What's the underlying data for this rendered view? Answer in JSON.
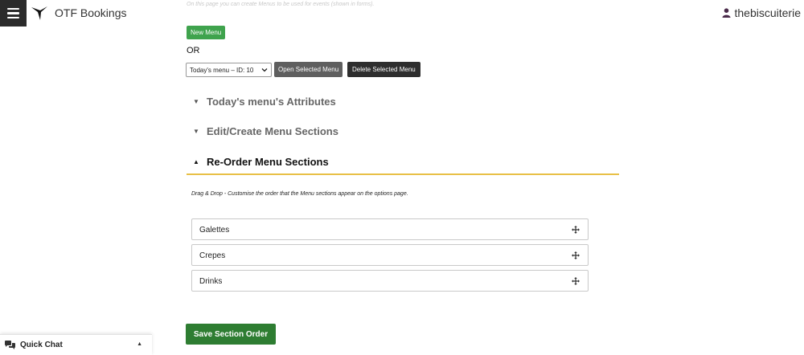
{
  "header": {
    "app_title": "OTF Bookings",
    "username": "thebiscuiterie",
    "menu_icon": "hamburger-icon",
    "logo_icon": "bird-logo-icon",
    "user_icon": "user-icon"
  },
  "intro_text": "On this page you can create Menus to be used for events (shown in forms).",
  "toolbar": {
    "new_menu_label": "New Menu",
    "or_label": "OR",
    "selected_menu": "Today's menu – ID: 10",
    "open_label": "Open Selected Menu",
    "delete_label": "Delete Selected Menu"
  },
  "accordion": [
    {
      "label": "Today's menu's Attributes",
      "expanded": false
    },
    {
      "label": "Edit/Create Menu Sections",
      "expanded": false
    },
    {
      "label": "Re-Order Menu Sections",
      "expanded": true
    }
  ],
  "reorder": {
    "note": "Drag & Drop - Customise the order that the Menu sections appear on the options page.",
    "items": [
      "Galettes",
      "Crepes",
      "Drinks"
    ],
    "save_label": "Save Section Order"
  },
  "quick_chat": {
    "label": "Quick Chat"
  },
  "colors": {
    "new_menu": "#3fa34d",
    "save": "#2e7d32",
    "accent_underline": "#e8c046",
    "dark_button": "#2e2e2e",
    "user_icon": "#4a2a4a"
  }
}
